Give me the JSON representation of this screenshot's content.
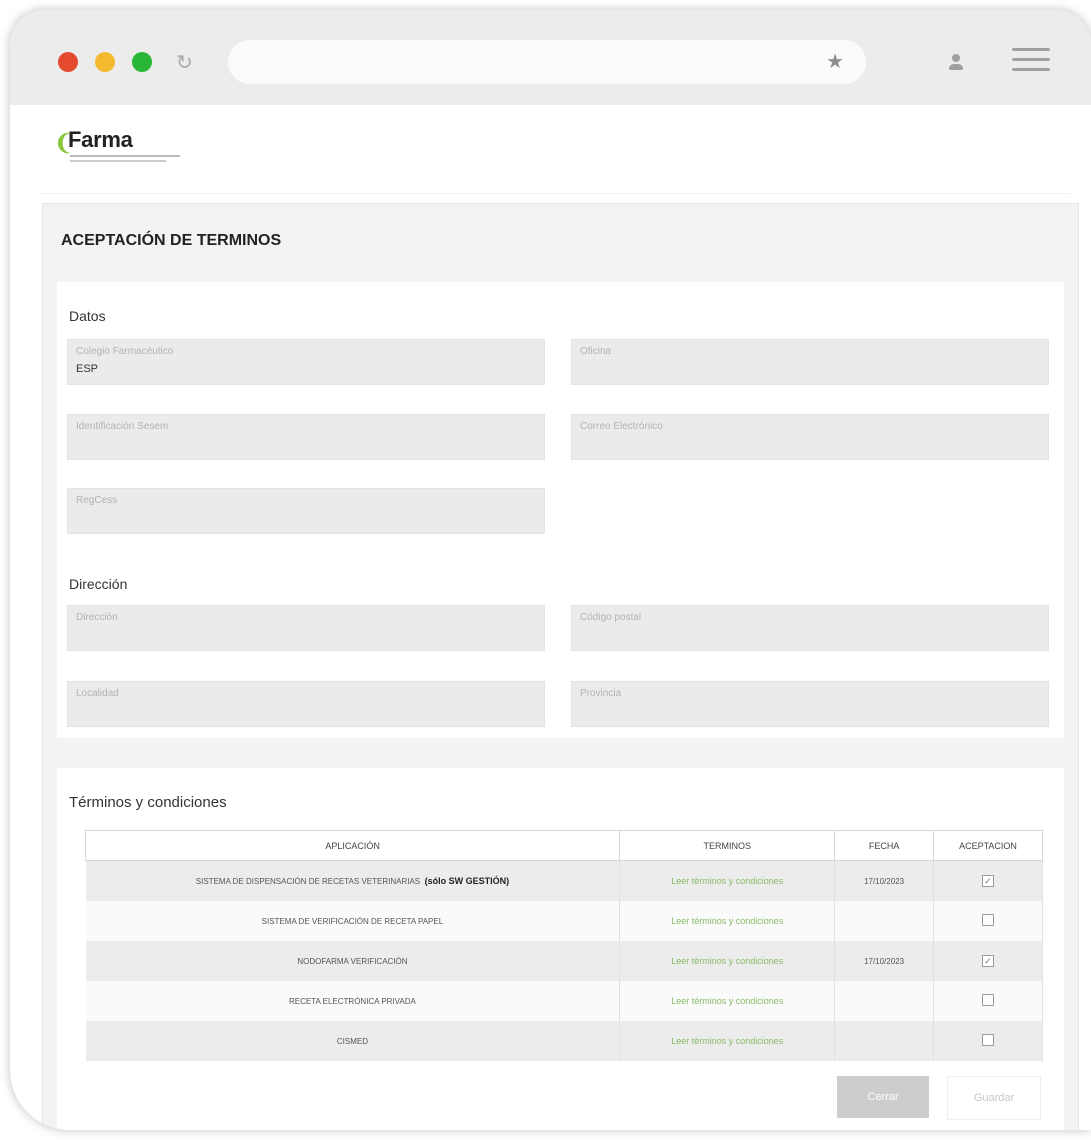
{
  "browser": {
    "dot_colors": [
      "#e64a2e",
      "#f4b92f",
      "#2bb736"
    ],
    "reload_icon": "reload-icon",
    "star_icon": "star-icon"
  },
  "app": {
    "logo_text": "Farma"
  },
  "page": {
    "title": "ACEPTACIÓN DE TERMINOS"
  },
  "datos": {
    "heading": "Datos",
    "fields": [
      {
        "label": "Colegio Farmacéutico",
        "value": "ESP"
      },
      {
        "label": "Oficina",
        "value": ""
      },
      {
        "label": "Identificación Sesem",
        "value": ""
      },
      {
        "label": "Correo Electrónico",
        "value": ""
      },
      {
        "label": "RegCess",
        "value": ""
      }
    ]
  },
  "direccion": {
    "heading": "Dirección",
    "fields": [
      {
        "label": "Dirección",
        "value": ""
      },
      {
        "label": "Código postal",
        "value": ""
      },
      {
        "label": "Localidad",
        "value": ""
      },
      {
        "label": "Provincia",
        "value": ""
      }
    ]
  },
  "terminos": {
    "heading": "Términos y condiciones",
    "columns": [
      "APLICACIÓN",
      "TERMINOS",
      "FECHA",
      "ACEPTACION"
    ],
    "rows": [
      {
        "app": "SISTEMA DE DISPENSACIÓN DE RECETAS VETERINARIAS",
        "app_bold": "(sólo SW GESTIÓN)",
        "link": "Leer términos y condiciones",
        "date": "17/10/2023",
        "accepted": true
      },
      {
        "app": "SISTEMA DE VERIFICACIÓN DE RECETA PAPEL",
        "app_bold": "",
        "link": "Leer términos y condiciones",
        "date": "",
        "accepted": false
      },
      {
        "app": "NODOFARMA VERIFICACIÓN",
        "app_bold": "",
        "link": "Leer términos y condiciones",
        "date": "17/10/2023",
        "accepted": true
      },
      {
        "app": "RECETA ELECTRÓNICA PRIVADA",
        "app_bold": "",
        "link": "Leer términos y condiciones",
        "date": "",
        "accepted": false
      },
      {
        "app": "CISMED",
        "app_bold": "",
        "link": "Leer términos y condiciones",
        "date": "",
        "accepted": false
      }
    ]
  },
  "actions": {
    "close_label": "Cerrar",
    "save_label": "Guardar"
  }
}
